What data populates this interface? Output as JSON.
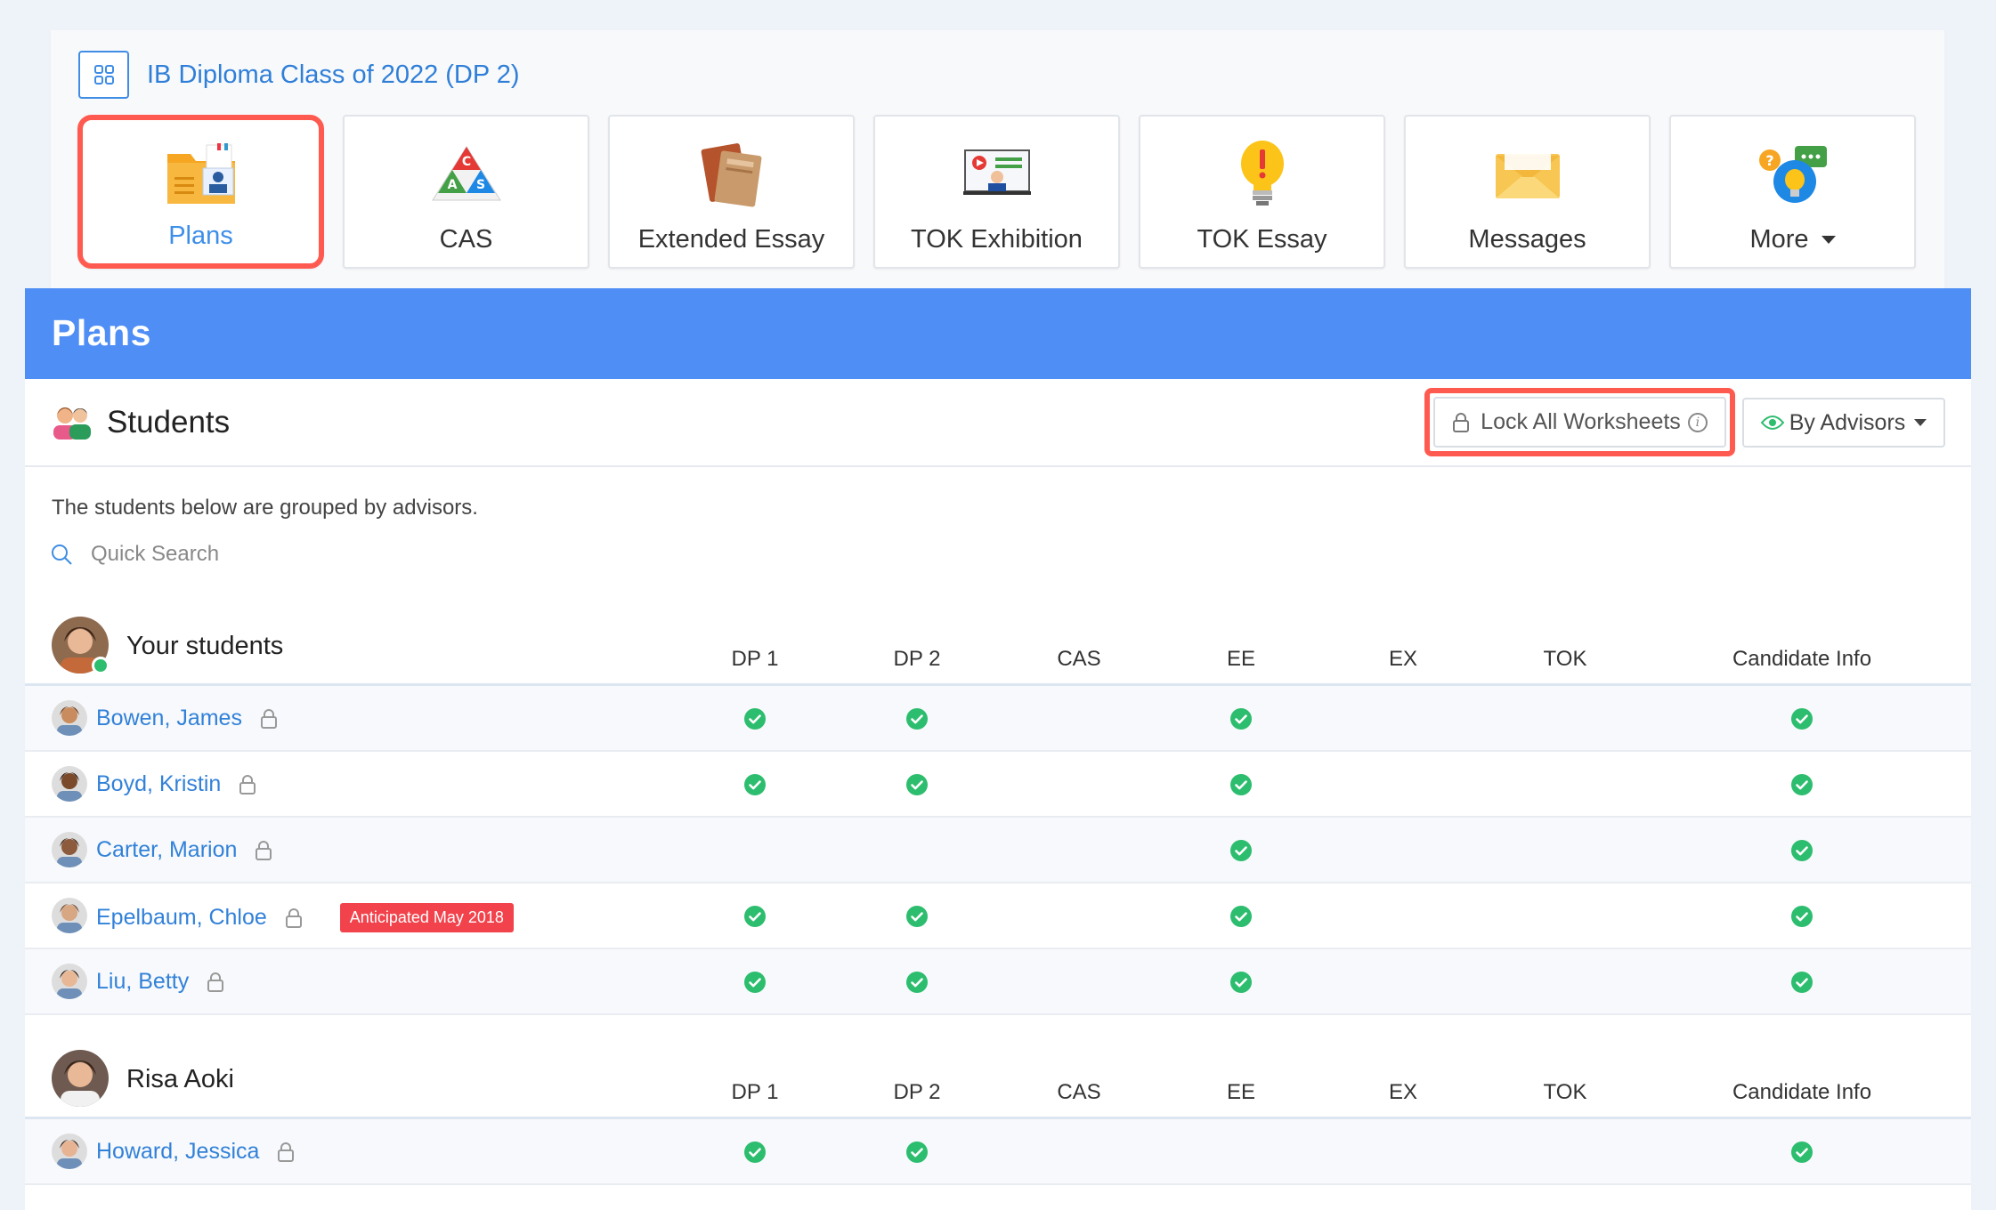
{
  "header": {
    "class_title": "IB Diploma Class of 2022 (DP 2)"
  },
  "tiles": [
    {
      "label": "Plans",
      "icon": "plans-folder-icon",
      "active": true
    },
    {
      "label": "CAS",
      "icon": "cas-triangle-icon",
      "active": false
    },
    {
      "label": "Extended Essay",
      "icon": "extended-essay-book-icon",
      "active": false
    },
    {
      "label": "TOK Exhibition",
      "icon": "tok-exhibition-board-icon",
      "active": false
    },
    {
      "label": "TOK Essay",
      "icon": "tok-essay-bulb-icon",
      "active": false
    },
    {
      "label": "Messages",
      "icon": "messages-envelope-icon",
      "active": false
    },
    {
      "label": "More",
      "icon": "more-bubbles-icon",
      "active": false
    }
  ],
  "plans": {
    "title": "Plans",
    "students_title": "Students",
    "lock_all_label": "Lock All Worksheets",
    "advisors_label": "By Advisors",
    "hint": "The students below are grouped by advisors.",
    "search_placeholder": "Quick Search"
  },
  "columns": [
    "DP 1",
    "DP 2",
    "CAS",
    "EE",
    "EX",
    "TOK",
    "Candidate Info"
  ],
  "groups": [
    {
      "name": "Your students",
      "students": [
        {
          "name": "Bowen, James",
          "badge": "",
          "checks": [
            true,
            true,
            false,
            true,
            false,
            false,
            true
          ]
        },
        {
          "name": "Boyd, Kristin",
          "badge": "",
          "checks": [
            true,
            true,
            false,
            true,
            false,
            false,
            true
          ]
        },
        {
          "name": "Carter, Marion",
          "badge": "",
          "checks": [
            false,
            false,
            false,
            true,
            false,
            false,
            true
          ]
        },
        {
          "name": "Epelbaum, Chloe",
          "badge": "Anticipated May 2018",
          "checks": [
            true,
            true,
            false,
            true,
            false,
            false,
            true
          ]
        },
        {
          "name": "Liu, Betty",
          "badge": "",
          "checks": [
            true,
            true,
            false,
            true,
            false,
            false,
            true
          ]
        }
      ]
    },
    {
      "name": "Risa Aoki",
      "students": [
        {
          "name": "Howard, Jessica",
          "badge": "",
          "checks": [
            true,
            true,
            false,
            false,
            false,
            false,
            true
          ]
        }
      ]
    }
  ],
  "colors": {
    "accent_blue": "#4f8ef5",
    "link_blue": "#3281d8",
    "highlight_red": "#ff5a4f",
    "badge_red": "#f2424b",
    "check_green": "#2dbd6e"
  }
}
